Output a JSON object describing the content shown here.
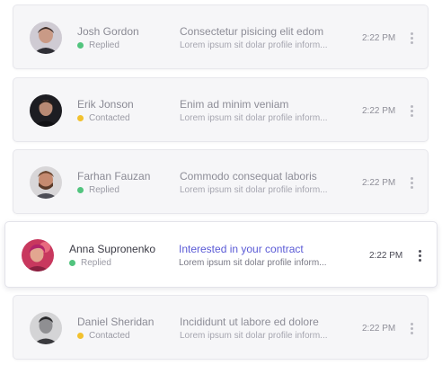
{
  "colors": {
    "replied": "#52c47e",
    "contacted": "#f2c12e",
    "active_subject": "#5a5ad6"
  },
  "conversations": [
    {
      "name": "Josh Gordon",
      "status": "Replied",
      "subject": "Consectetur pisicing elit edom",
      "preview": "Lorem ipsum sit dolar profile inform...",
      "time": "2:22 PM",
      "avatar": "avatar-photo",
      "menu_icon": "kebab-menu-icon"
    },
    {
      "name": "Erik Jonson",
      "status": "Contacted",
      "subject": "Enim ad minim veniam",
      "preview": "Lorem ipsum sit dolar profile inform...",
      "time": "2:22 PM",
      "avatar": "avatar-photo",
      "menu_icon": "kebab-menu-icon"
    },
    {
      "name": "Farhan Fauzan",
      "status": "Replied",
      "subject": "Commodo consequat laboris",
      "preview": "Lorem ipsum sit dolar profile inform...",
      "time": "2:22 PM",
      "avatar": "avatar-photo",
      "menu_icon": "kebab-menu-icon"
    },
    {
      "name": "Anna Supronenko",
      "status": "Replied",
      "subject": "Interested in your contract",
      "preview": "Lorem ipsum sit dolar profile inform...",
      "time": "2:22 PM",
      "avatar": "avatar-photo",
      "menu_icon": "kebab-menu-icon",
      "selected": true
    },
    {
      "name": "Daniel Sheridan",
      "status": "Contacted",
      "subject": "Incididunt ut labore ed dolore",
      "preview": "Lorem ipsum sit dolar profile inform...",
      "time": "2:22 PM",
      "avatar": "avatar-photo",
      "menu_icon": "kebab-menu-icon"
    }
  ]
}
